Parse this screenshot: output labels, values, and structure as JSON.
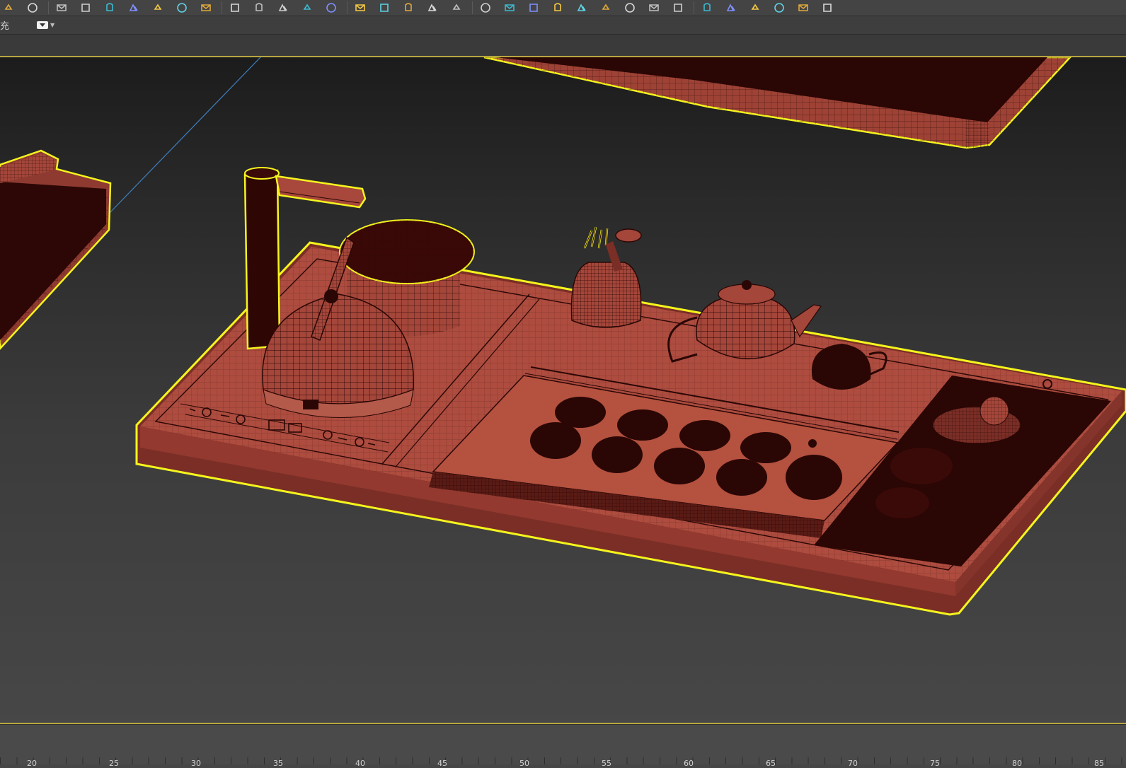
{
  "ribbon": {
    "label": "充",
    "dropdown_icon": "viewport-layout-icon"
  },
  "toolbar": {
    "icons": [
      "sun-icon",
      "spark-icon",
      "box-icon",
      "sphere-icon",
      "envelope-icon",
      "image-icon",
      "cup-icon",
      "curve-icon",
      "sphere-material-icon",
      "paint-icon",
      "undo-arrow-icon",
      "clipboard-icon",
      "graph-icon",
      "check-circle-icon",
      "tree-icon",
      "frame-icon",
      "clock-icon",
      "render-icon",
      "arc-icon",
      "monitor-icon",
      "screen-icon",
      "gear-icon",
      "film-icon",
      "film-render-icon",
      "cube-purple-icon",
      "bar-chart-icon",
      "edit-icon",
      "table-icon",
      "edit-alt-icon",
      "render-frame-icon",
      "render-setup-icon",
      "render-active-icon",
      "teapot-icon",
      "material-editor-icon"
    ]
  },
  "timeline": {
    "labels": [
      "20",
      "25",
      "30",
      "35",
      "40",
      "45",
      "50",
      "55",
      "60",
      "65",
      "70",
      "75",
      "80",
      "85"
    ]
  },
  "colors": {
    "wire_fill": "#a4463a",
    "wire_dark": "#2a0705",
    "selection": "#f5f51e",
    "timeline_accent": "#b8a642"
  }
}
